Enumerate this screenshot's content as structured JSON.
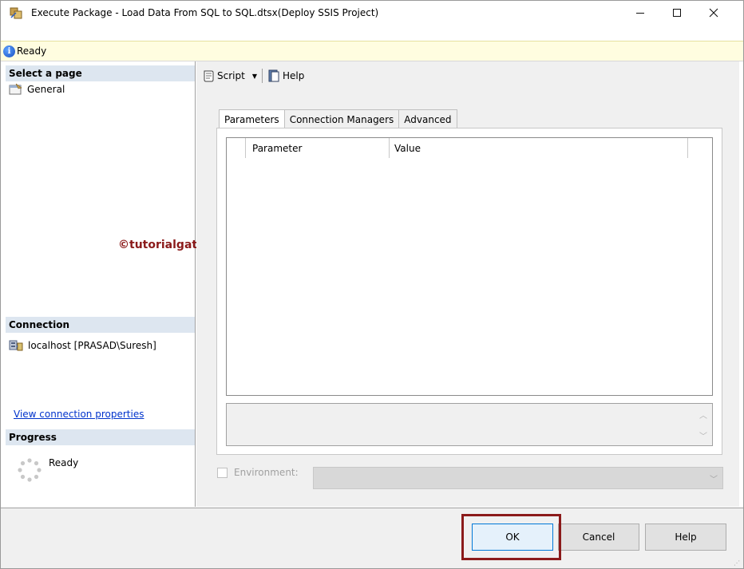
{
  "window": {
    "title": "Execute Package - Load Data From SQL to SQL.dtsx(Deploy SSIS Project)"
  },
  "status": {
    "text": "Ready"
  },
  "left_panel": {
    "select_page_header": "Select a page",
    "pages": [
      {
        "label": "General"
      }
    ],
    "connection_header": "Connection",
    "connection_value": "localhost [PRASAD\\Suresh]",
    "view_connection_link": "View connection properties",
    "progress_header": "Progress",
    "progress_text": "Ready"
  },
  "watermark": "©tutorialgateway.org",
  "toolbar": {
    "script_label": "Script",
    "help_label": "Help"
  },
  "tabs": [
    {
      "label": "Parameters",
      "active": true
    },
    {
      "label": "Connection Managers",
      "active": false
    },
    {
      "label": "Advanced",
      "active": false
    }
  ],
  "grid": {
    "columns": [
      "Parameter",
      "Value"
    ]
  },
  "environment": {
    "label": "Environment:",
    "checked": false,
    "selected": ""
  },
  "buttons": {
    "ok": "OK",
    "cancel": "Cancel",
    "help": "Help"
  },
  "colors": {
    "highlight": "#8b1a1a",
    "status_bg": "#fffde0",
    "section_bg": "#dde6f0",
    "link": "#0033cc"
  }
}
